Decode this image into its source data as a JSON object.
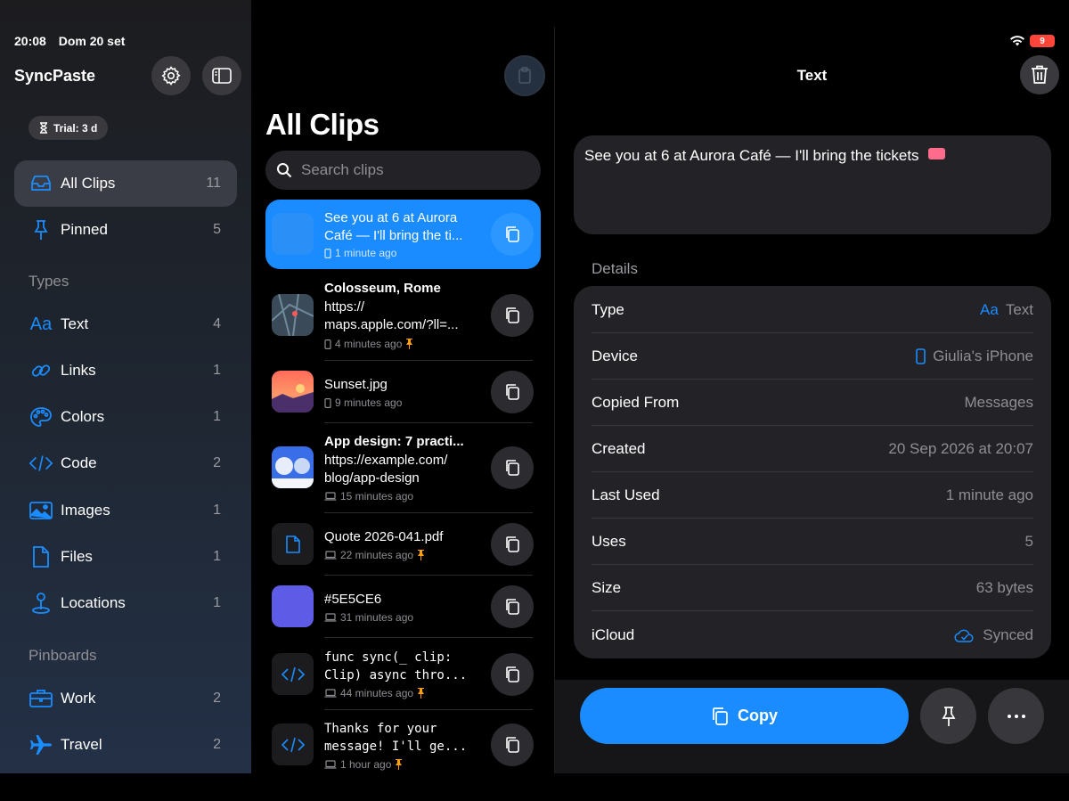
{
  "status": {
    "time": "20:08",
    "date": "Dom 20 set",
    "battery": "9"
  },
  "sidebar": {
    "app_title": "SyncPaste",
    "settings_icon": "gear-icon",
    "toggle_icon": "sidebar-icon",
    "trial_badge": "Trial: 3 d",
    "main_items": [
      {
        "label": "All Clips",
        "count": "11",
        "icon": "tray-icon"
      },
      {
        "label": "Pinned",
        "count": "5",
        "icon": "pin-icon"
      }
    ],
    "types_title": "Types",
    "types": [
      {
        "label": "Text",
        "count": "4",
        "icon": "text-icon"
      },
      {
        "label": "Links",
        "count": "1",
        "icon": "link-icon"
      },
      {
        "label": "Colors",
        "count": "1",
        "icon": "palette-icon"
      },
      {
        "label": "Code",
        "count": "2",
        "icon": "code-icon"
      },
      {
        "label": "Images",
        "count": "1",
        "icon": "image-icon"
      },
      {
        "label": "Files",
        "count": "1",
        "icon": "file-icon"
      },
      {
        "label": "Locations",
        "count": "1",
        "icon": "location-pin-icon"
      }
    ],
    "pinboards_title": "Pinboards",
    "pinboards": [
      {
        "label": "Work",
        "count": "2",
        "icon": "briefcase-icon"
      },
      {
        "label": "Travel",
        "count": "2",
        "icon": "airplane-icon"
      }
    ]
  },
  "list": {
    "title": "All Clips",
    "search_placeholder": "Search clips",
    "clips": [
      {
        "title": "See you at 6 at Aurora",
        "title2": "Café — I'll bring the ti...",
        "meta": "1 minute ago",
        "device": "phone",
        "pinned": false
      },
      {
        "title": "Colosseum, Rome",
        "line1": "https://",
        "line2": "maps.apple.com/?ll=...",
        "meta": "4 minutes ago",
        "device": "phone",
        "pinned": true
      },
      {
        "title": "Sunset.jpg",
        "meta": "9 minutes ago",
        "device": "phone",
        "pinned": false
      },
      {
        "title": "App design: 7 practi...",
        "line1": "https://example.com/",
        "line2": "blog/app-design",
        "meta": "15 minutes ago",
        "device": "laptop",
        "pinned": false
      },
      {
        "title": "Quote 2026-041.pdf",
        "meta": "22 minutes ago",
        "device": "laptop",
        "pinned": true
      },
      {
        "title": "#5E5CE6",
        "meta": "31 minutes ago",
        "device": "laptop",
        "pinned": false,
        "color": "#5E5CE6"
      },
      {
        "line1": "func sync(_ clip:",
        "line2": "Clip) async thro...",
        "meta": "44 minutes ago",
        "device": "laptop",
        "pinned": true
      },
      {
        "line1": "Thanks for your",
        "line2": "message! I'll ge...",
        "meta": "1 hour ago",
        "device": "laptop",
        "pinned": true
      }
    ]
  },
  "detail": {
    "title": "Text",
    "content": "See you at 6 at Aurora Café — I'll bring the tickets",
    "details_label": "Details",
    "rows": [
      {
        "key": "Type",
        "icon_text": "Aa",
        "value": "Text"
      },
      {
        "key": "Device",
        "value": "Giulia's iPhone"
      },
      {
        "key": "Copied From",
        "value": "Messages"
      },
      {
        "key": "Created",
        "value": "20 Sep 2026 at 20:07"
      },
      {
        "key": "Last Used",
        "value": "1 minute ago"
      },
      {
        "key": "Uses",
        "value": "5"
      },
      {
        "key": "Size",
        "value": "63 bytes"
      },
      {
        "key": "iCloud",
        "value": "Synced"
      }
    ],
    "copy_label": "Copy",
    "accent": "#1A8CFF"
  }
}
